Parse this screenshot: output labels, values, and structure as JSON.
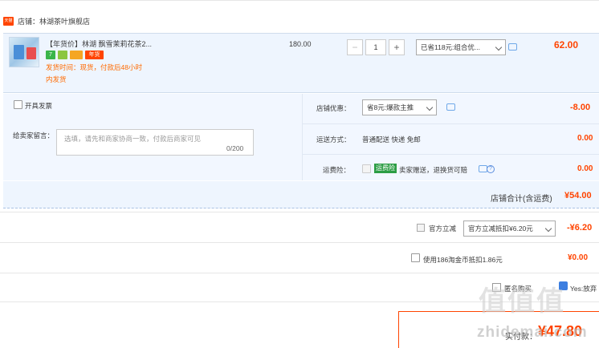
{
  "shop": {
    "tag": "天猫",
    "name": "店铺：林湖茶叶旗舰店"
  },
  "item": {
    "title": "【年货价】林湖 飘雪茉莉花茶2...",
    "badges": [
      "7",
      "",
      "",
      "年货"
    ],
    "ship_line1": "发货时间：现货，付款后48小时",
    "ship_line2": "内发货",
    "unit_price": "180.00",
    "quantity": "1",
    "dec_label": "−",
    "inc_label": "+",
    "discount_select": "已省118元:组合优...",
    "total": "62.00"
  },
  "options": {
    "invoice_label": "开具发票",
    "shop_discount_label": "店铺优惠：",
    "shop_discount_select": "省8元:爆款主推",
    "shop_discount_value": "-8.00",
    "message_label": "给卖家留言：",
    "message_placeholder": "选填，请先和商家协商一致，付款后商家可见",
    "message_count": "0/200",
    "shipping_label": "运送方式：",
    "shipping_value": "普通配送 快递 免邮",
    "shipping_cost": "0.00",
    "insurance_label": "运费险：",
    "insurance_badge": "运费险",
    "insurance_text": "卖家赠送，退换货可赔",
    "insurance_cost": "0.00",
    "help_icon_label": "?"
  },
  "shop_total": {
    "label": "店铺合计(含运费)",
    "value": "¥54.00"
  },
  "platform": {
    "label": "官方立减",
    "select": "官方立减抵扣¥6.20元",
    "value": "-¥6.20"
  },
  "coins": {
    "label": "使用186淘金币抵扣1.86元",
    "value": "¥0.00"
  },
  "footer": {
    "left_label": "匿名购买",
    "right_label": "Yes:放弃"
  },
  "payment": {
    "label": "实付款：",
    "value": "¥47.80"
  },
  "watermark": {
    "main": "值值值",
    "sub": "zhidemai.com"
  }
}
